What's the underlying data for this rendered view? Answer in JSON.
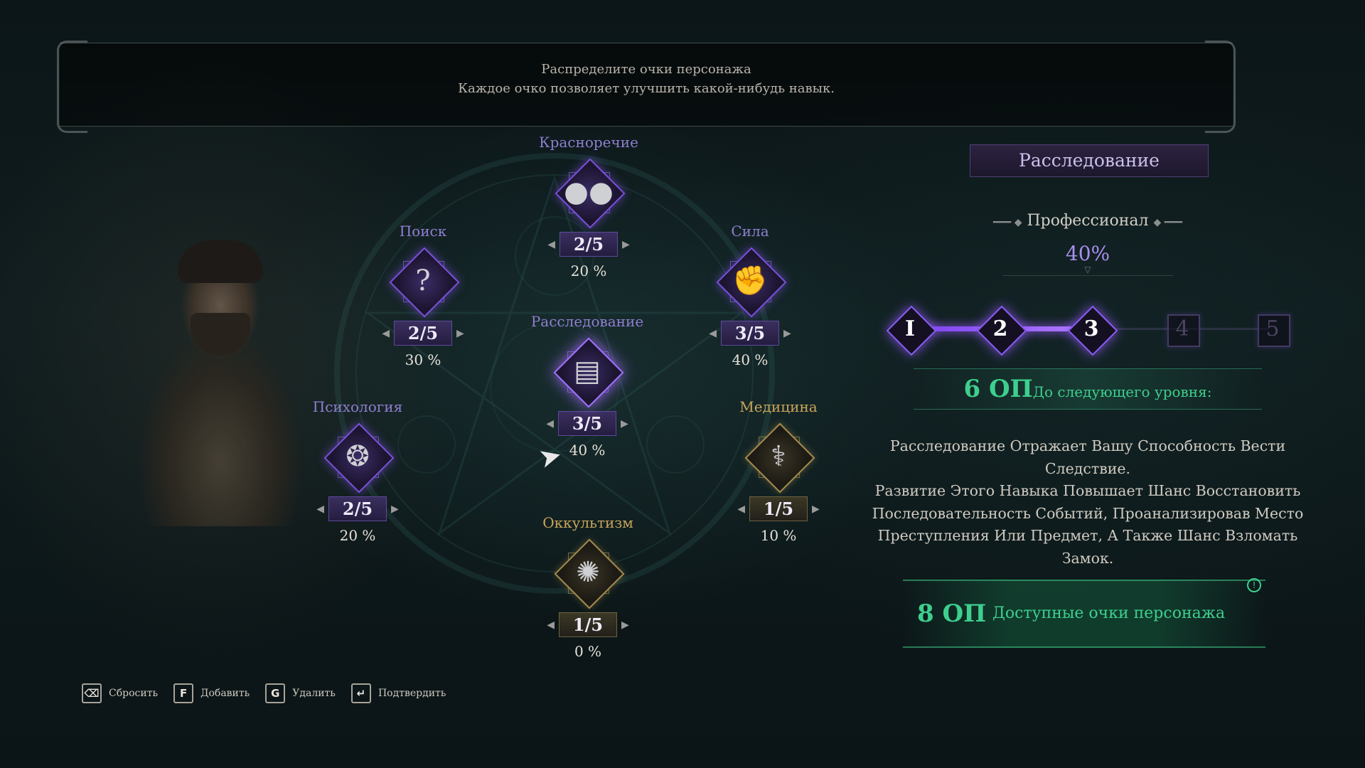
{
  "banner": {
    "line1": "Распределите очки персонажа",
    "line2": "Каждое очко позволяет улучшить какой-нибудь навык."
  },
  "skills": {
    "eloquence": {
      "name": "Красноречие",
      "level": "2/5",
      "pct": "20 %",
      "icon": "speech-bubbles-icon"
    },
    "search": {
      "name": "Поиск",
      "level": "2/5",
      "pct": "30 %",
      "icon": "question-mark-icon"
    },
    "strength": {
      "name": "Сила",
      "level": "3/5",
      "pct": "40 %",
      "icon": "fist-icon"
    },
    "investigation": {
      "name": "Расследование",
      "level": "3/5",
      "pct": "40 %",
      "icon": "documents-icon"
    },
    "psychology": {
      "name": "Психология",
      "level": "2/5",
      "pct": "20 %",
      "icon": "brain-icon"
    },
    "medicine": {
      "name": "Медицина",
      "level": "1/5",
      "pct": "10 %",
      "icon": "caduceus-icon"
    },
    "occultism": {
      "name": "Оккультизм",
      "level": "1/5",
      "pct": "0 %",
      "icon": "occult-sigil-icon"
    }
  },
  "detail": {
    "title": "Расследование",
    "rank": "Профессионал",
    "rank_pct": "40%",
    "levels": [
      "I",
      "2",
      "3",
      "4",
      "5"
    ],
    "unlocked_levels": 3,
    "next_points": "6 ОП",
    "next_label": "До следующего уровня:",
    "description": [
      "Расследование Отражает Вашу Способность Вести",
      "Следствие.",
      "Развитие Этого Навыка Повышает Шанс Восстановить",
      "Последовательность Событий, Проанализировав Место",
      "Преступления Или Предмет, А Также Шанс Взломать Замок."
    ],
    "available_points": "8 ОП",
    "available_label": "Доступные очки персонажа",
    "info_glyph": "!"
  },
  "hints": [
    {
      "key": "⌫",
      "label": "Сбросить"
    },
    {
      "key": "F",
      "label": "Добавить"
    },
    {
      "key": "G",
      "label": "Удалить"
    },
    {
      "key": "↵",
      "label": "Подтвердить"
    }
  ],
  "colors": {
    "purple_accent": "#8b5cf6",
    "green_accent": "#3ecf8e",
    "gold_accent": "#c9a55a"
  }
}
